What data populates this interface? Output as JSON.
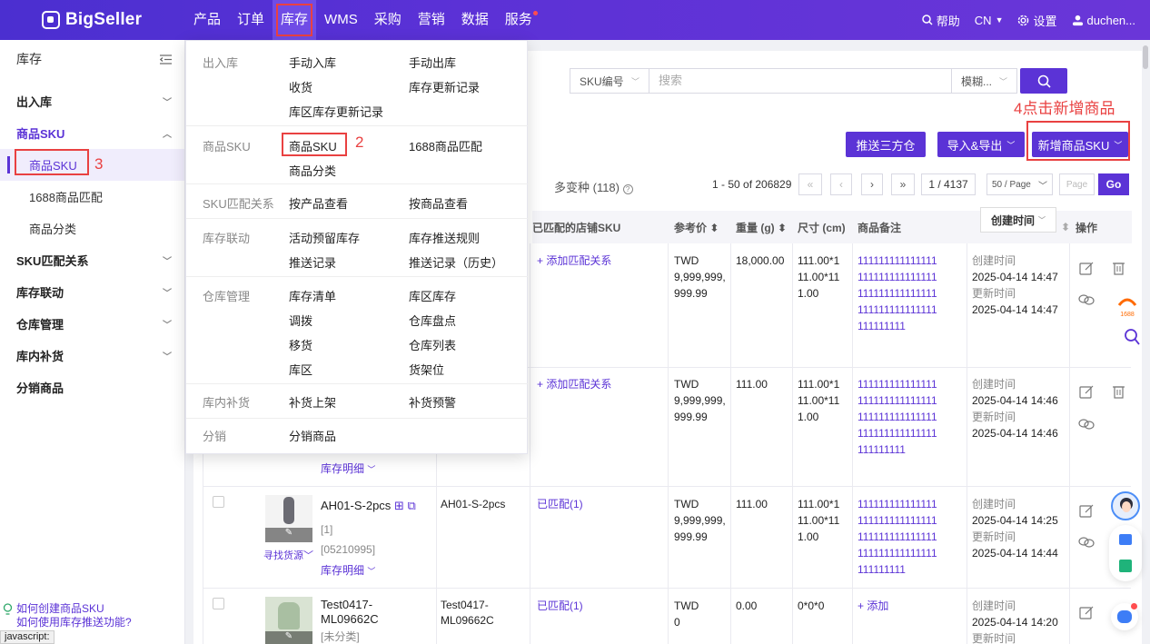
{
  "topnav": {
    "brand": "BigSeller",
    "items": [
      "产品",
      "订单",
      "库存",
      "WMS",
      "采购",
      "营销",
      "数据",
      "服务"
    ],
    "help": "帮助",
    "lang": "CN",
    "settings": "设置",
    "user": "duchen..."
  },
  "sidebar": {
    "title": "库存",
    "sections": [
      {
        "label": "出入库"
      },
      {
        "label": "商品SKU",
        "expanded": true,
        "children": [
          "商品SKU",
          "1688商品匹配",
          "商品分类"
        ]
      },
      {
        "label": "SKU匹配关系"
      },
      {
        "label": "库存联动"
      },
      {
        "label": "仓库管理"
      },
      {
        "label": "库内补货"
      },
      {
        "label": "分销商品"
      }
    ],
    "footer": [
      "如何创建商品SKU",
      "如何使用库存推送功能?"
    ],
    "annotation": "3"
  },
  "status_bar": "javascript:",
  "mega_menu": {
    "annotation": "2",
    "groups": [
      {
        "cat": "出入库",
        "links": [
          "手动入库",
          "手动出库",
          "收货",
          "库存更新记录",
          "库区库存更新记录"
        ]
      },
      {
        "cat": "商品SKU",
        "links": [
          "商品SKU",
          "1688商品匹配",
          "商品分类"
        ]
      },
      {
        "cat": "SKU匹配关系",
        "links": [
          "按产品查看",
          "按商品查看"
        ]
      },
      {
        "cat": "库存联动",
        "links": [
          "活动预留库存",
          "库存推送规则",
          "推送记录",
          "推送记录（历史）"
        ]
      },
      {
        "cat": "仓库管理",
        "links": [
          "库存清单",
          "库区库存",
          "调拨",
          "仓库盘点",
          "移货",
          "仓库列表",
          "库区",
          "货架位"
        ]
      },
      {
        "cat": "库内补货",
        "links": [
          "补货上架",
          "补货预警"
        ]
      },
      {
        "cat": "分销",
        "links": [
          "分销商品"
        ]
      }
    ]
  },
  "search": {
    "field": "SKU编号",
    "placeholder": "搜索",
    "mode": "模糊..."
  },
  "annotation_4": "4点击新增商品",
  "buttons": {
    "push": "推送三方仓",
    "import_export": "导入&导出",
    "add_sku": "新增商品SKU"
  },
  "variants": "多变种 (118)",
  "pager": {
    "range": "1 - 50 of 206829",
    "page": "1 / 4137",
    "per_page": "50 / Page",
    "page_placeholder": "Page",
    "go": "Go"
  },
  "table": {
    "headers": [
      "已匹配的店铺SKU",
      "参考价",
      "重量 (g)",
      "尺寸 (cm)",
      "商品备注",
      "创建时间",
      "操作"
    ],
    "rows": [
      {
        "match": "+ 添加匹配关系",
        "price": [
          "TWD",
          "9,999,999,",
          "999.99"
        ],
        "weight": "18,000.00",
        "size": [
          "111.00*1",
          "11.00*11",
          "1.00"
        ],
        "note": [
          "111111111111111",
          "111111111111111",
          "111111111111111",
          "111111111111111",
          "111111111"
        ],
        "created_label": "创建时间",
        "created": "2025-04-14 14:47",
        "updated_label": "更新时间",
        "updated": "2025-04-14 14:47"
      },
      {
        "match": "+ 添加匹配关系",
        "price": [
          "TWD",
          "9,999,999,",
          "999.99"
        ],
        "weight": "111.00",
        "size": [
          "111.00*1",
          "11.00*11",
          "1.00"
        ],
        "note": [
          "111111111111111",
          "111111111111111",
          "111111111111111",
          "111111111111111",
          "111111111"
        ],
        "created_label": "创建时间",
        "created": "2025-04-14 14:46",
        "updated_label": "更新时间",
        "updated": "2025-04-14 14:46",
        "stock_detail": "库存明细"
      },
      {
        "name": "AH01-S-2pcs",
        "qty": "[1]",
        "code": "[05210995]",
        "stock_detail": "库存明细",
        "source": "寻找货源",
        "sku": "AH01-S-2pcs",
        "match": "已匹配(1)",
        "price": [
          "TWD",
          "9,999,999,",
          "999.99"
        ],
        "weight": "111.00",
        "size": [
          "111.00*1",
          "11.00*11",
          "1.00"
        ],
        "note": [
          "111111111111111",
          "111111111111111",
          "111111111111111",
          "111111111111111",
          "111111111"
        ],
        "created_label": "创建时间",
        "created": "2025-04-14 14:25",
        "updated_label": "更新时间",
        "updated": "2025-04-14 14:44"
      },
      {
        "name": [
          "Test0417-",
          "ML09662C"
        ],
        "qty": "[未分类]",
        "sku": [
          "Test0417-",
          "ML09662C"
        ],
        "match": "已匹配(1)",
        "price": [
          "TWD",
          "0"
        ],
        "weight": "0.00",
        "size": [
          "0*0*0"
        ],
        "note_add": "+ 添加",
        "created_label": "创建时间",
        "created": "2025-04-14 14:20",
        "updated_label": "更新时间"
      }
    ]
  },
  "colors": {
    "brand": "#5b33d6",
    "annotation": "#e94141"
  }
}
